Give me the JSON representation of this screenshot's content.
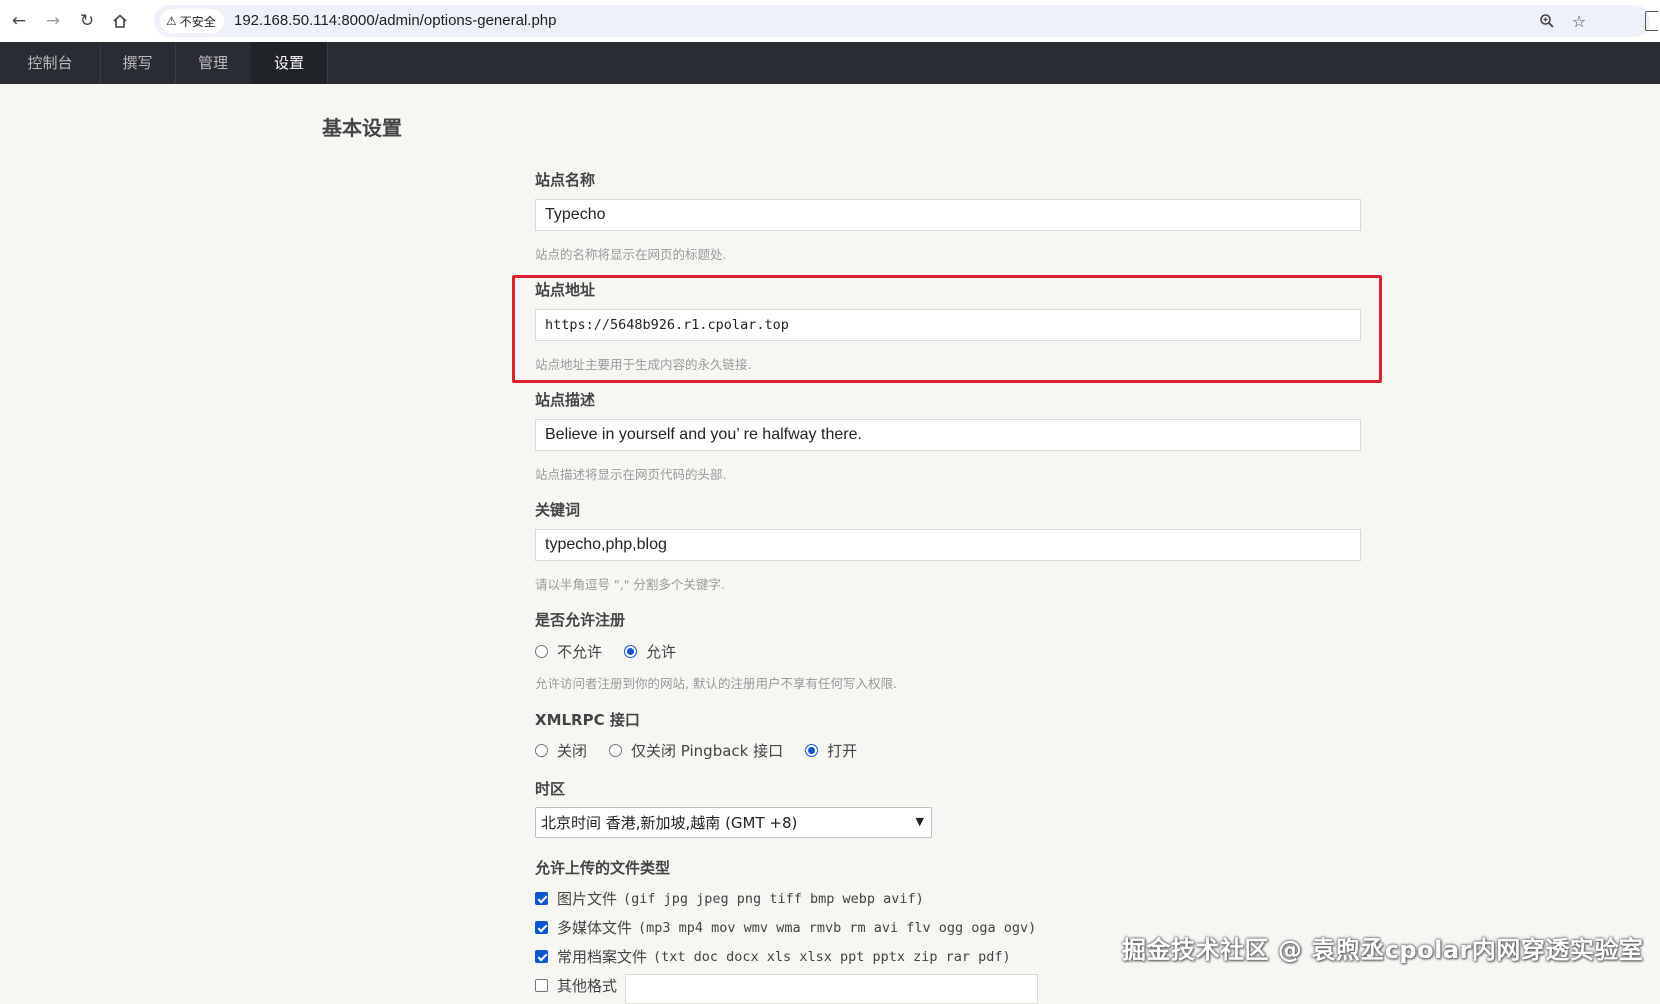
{
  "browser": {
    "security_label": "不安全",
    "url": "192.168.50.114:8000/admin/options-general.php",
    "back_icon": "arrow-left-icon",
    "forward_icon": "arrow-right-icon",
    "reload_icon": "reload-icon",
    "home_icon": "home-icon",
    "zoom_icon": "zoom-icon",
    "bookmark_icon": "star-icon"
  },
  "admin_nav": {
    "tabs": [
      {
        "label": "控制台",
        "active": false
      },
      {
        "label": "撰写",
        "active": false
      },
      {
        "label": "管理",
        "active": false
      },
      {
        "label": "设置",
        "active": true
      }
    ]
  },
  "page": {
    "title": "基本设置",
    "site_name": {
      "label": "站点名称",
      "value": "Typecho",
      "description": "站点的名称将显示在网页的标题处."
    },
    "site_url": {
      "label": "站点地址",
      "value": "https://5648b926.r1.cpolar.top",
      "description": "站点地址主要用于生成内容的永久链接.",
      "highlight_color": "#d9232e"
    },
    "site_description": {
      "label": "站点描述",
      "value": "Believe in yourself and you’ re halfway there.",
      "description": "站点描述将显示在网页代码的头部."
    },
    "keywords": {
      "label": "关键词",
      "value": "typecho,php,blog",
      "description": "请以半角逗号 \",\" 分割多个关键字."
    },
    "allow_register": {
      "label": "是否允许注册",
      "options": [
        {
          "label": "不允许",
          "checked": false
        },
        {
          "label": "允许",
          "checked": true
        }
      ],
      "description": "允许访问者注册到你的网站, 默认的注册用户不享有任何写入权限."
    },
    "xmlrpc": {
      "label": "XMLRPC 接口",
      "options": [
        {
          "label": "关闭",
          "checked": false
        },
        {
          "label": "仅关闭 Pingback 接口",
          "checked": false
        },
        {
          "label": "打开",
          "checked": true
        }
      ]
    },
    "timezone": {
      "label": "时区",
      "selected": "北京时间 香港,新加坡,越南 (GMT +8)"
    },
    "upload_types": {
      "label": "允许上传的文件类型",
      "items": [
        {
          "label": "图片文件",
          "exts": "(gif jpg jpeg png tiff bmp webp avif)",
          "checked": true
        },
        {
          "label": "多媒体文件",
          "exts": "(mp3 mp4 mov wmv wma rmvb rm avi flv ogg oga ogv)",
          "checked": true
        },
        {
          "label": "常用档案文件",
          "exts": "(txt doc docx xls xlsx ppt pptx zip rar pdf)",
          "checked": true
        },
        {
          "label": "其他格式",
          "exts": "",
          "checked": false
        }
      ]
    }
  },
  "watermark": "掘金技术社区 @ 袁煦丞cpolar内网穿透实验室",
  "colors": {
    "admin_bar": "#292d33",
    "accent": "#0b57d0",
    "background": "#f6f6f3"
  }
}
